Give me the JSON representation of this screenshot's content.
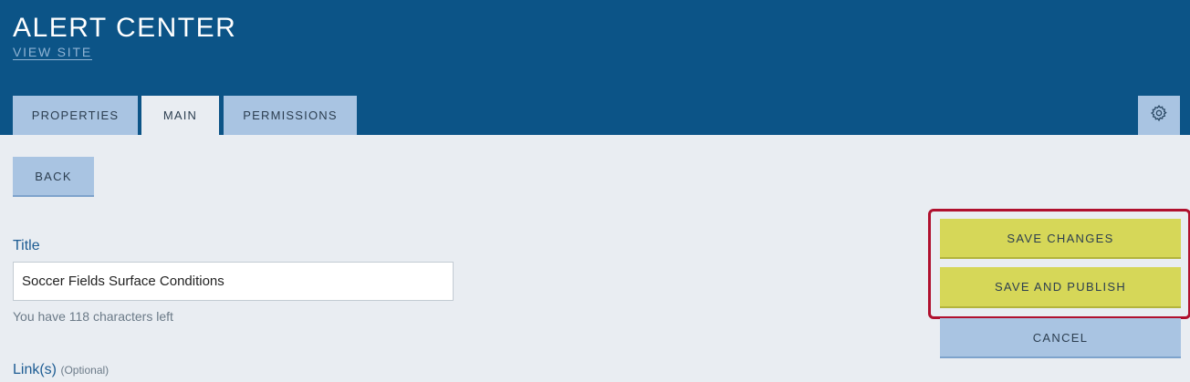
{
  "header": {
    "app_title": "ALERT CENTER",
    "view_site_link": "VIEW SITE"
  },
  "tabs": [
    {
      "label": "PROPERTIES",
      "active": false
    },
    {
      "label": "MAIN",
      "active": true
    },
    {
      "label": "PERMISSIONS",
      "active": false
    }
  ],
  "actions": {
    "back": "BACK",
    "save_changes": "SAVE CHANGES",
    "save_and_publish": "SAVE AND PUBLISH",
    "cancel": "CANCEL"
  },
  "form": {
    "title_label": "Title",
    "title_value": "Soccer Fields Surface Conditions",
    "char_count_text": "You have 118 characters left",
    "links_label": "Link(s)",
    "links_optional": "(Optional)"
  },
  "colors": {
    "header_bg": "#0c5487",
    "tab_bg": "#a9c4e2",
    "page_bg": "#e9edf2",
    "save_btn": "#d6d758",
    "highlight": "#b0102e"
  },
  "icons": {
    "settings": "gear-icon"
  }
}
